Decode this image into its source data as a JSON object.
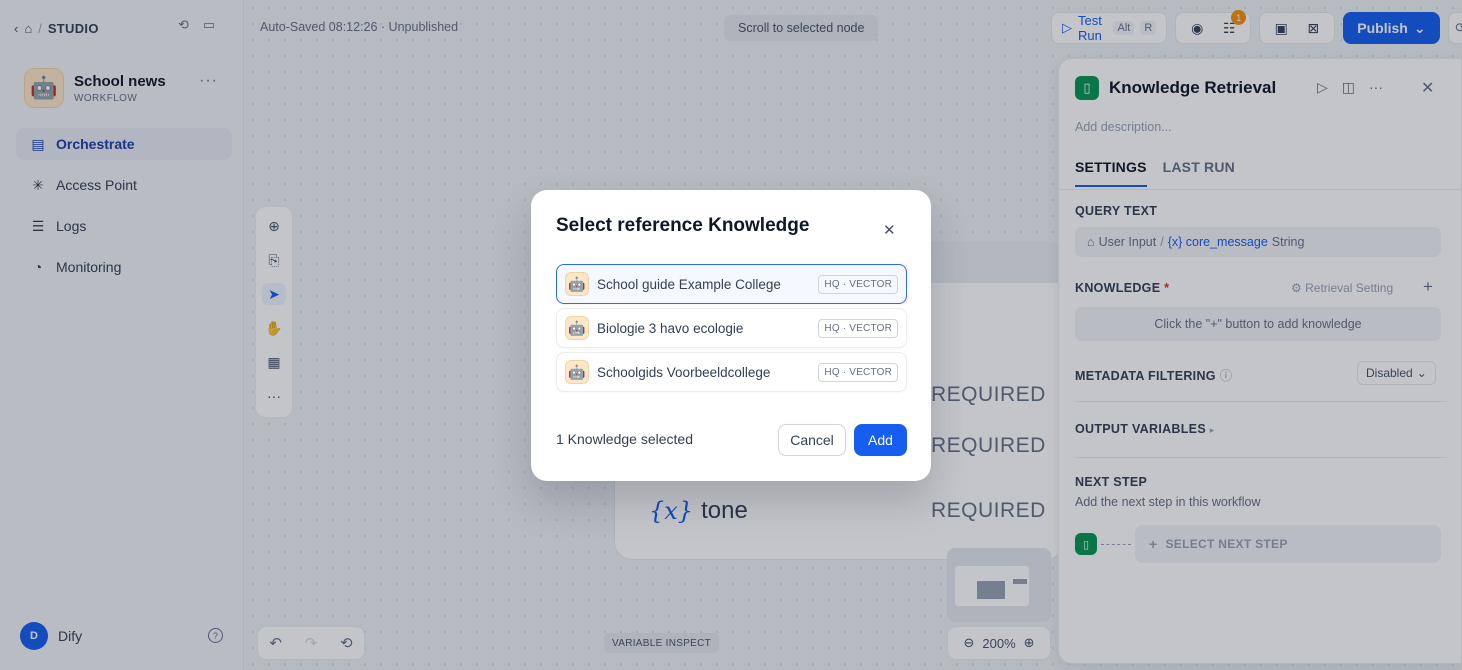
{
  "topbar": {
    "studio": "STUDIO"
  },
  "app": {
    "name": "School news",
    "type": "WORKFLOW",
    "emoji": "🤖"
  },
  "nav": [
    {
      "label": "Orchestrate",
      "icon": "orchestrate-icon"
    },
    {
      "label": "Access Point",
      "icon": "access-point-icon"
    },
    {
      "label": "Logs",
      "icon": "logs-icon"
    },
    {
      "label": "Monitoring",
      "icon": "monitoring-icon"
    }
  ],
  "user": {
    "initial": "D",
    "name": "Dify"
  },
  "canvas": {
    "autosave": "Auto-Saved 08:12:26 · Unpublished",
    "scroll_btn": "Scroll to selected node",
    "variable_inspect": "VARIABLE INSPECT",
    "zoom": "200%"
  },
  "toolbar": {
    "test_run": "Test Run",
    "kbd_alt": "Alt",
    "kbd_r": "R",
    "badge_count": "1",
    "publish": "Publish"
  },
  "node_vars": [
    {
      "name": "tone",
      "required": "REQUIRED"
    }
  ],
  "node_required": [
    "REQUIRED",
    "REQUIRED",
    "REQUIRED"
  ],
  "panel": {
    "title": "Knowledge Retrieval",
    "description": "Add description...",
    "tabs": [
      "SETTINGS",
      "LAST RUN"
    ],
    "query_label": "QUERY TEXT",
    "query_source": "User Input",
    "query_slash": "/",
    "query_var": "{x} core_message",
    "query_type": "String",
    "knowledge_label": "KNOWLEDGE",
    "required_mark": "*",
    "retrieval_setting": "Retrieval Setting",
    "knowledge_empty": "Click the \"+\" button to add knowledge",
    "metadata_label": "METADATA FILTERING",
    "metadata_value": "Disabled",
    "output_label": "OUTPUT VARIABLES",
    "next_label": "NEXT STEP",
    "next_desc": "Add the next step in this workflow",
    "next_select": "SELECT NEXT STEP"
  },
  "modal": {
    "title": "Select reference Knowledge",
    "items": [
      {
        "name": "School guide Example College",
        "tag": "HQ · VECTOR",
        "selected": true
      },
      {
        "name": "Biologie 3 havo ecologie",
        "tag": "HQ · VECTOR",
        "selected": false
      },
      {
        "name": "Schoolgids Voorbeeldcollege",
        "tag": "HQ · VECTOR",
        "selected": false
      }
    ],
    "selected_count": "1 Knowledge selected",
    "cancel": "Cancel",
    "add": "Add"
  }
}
